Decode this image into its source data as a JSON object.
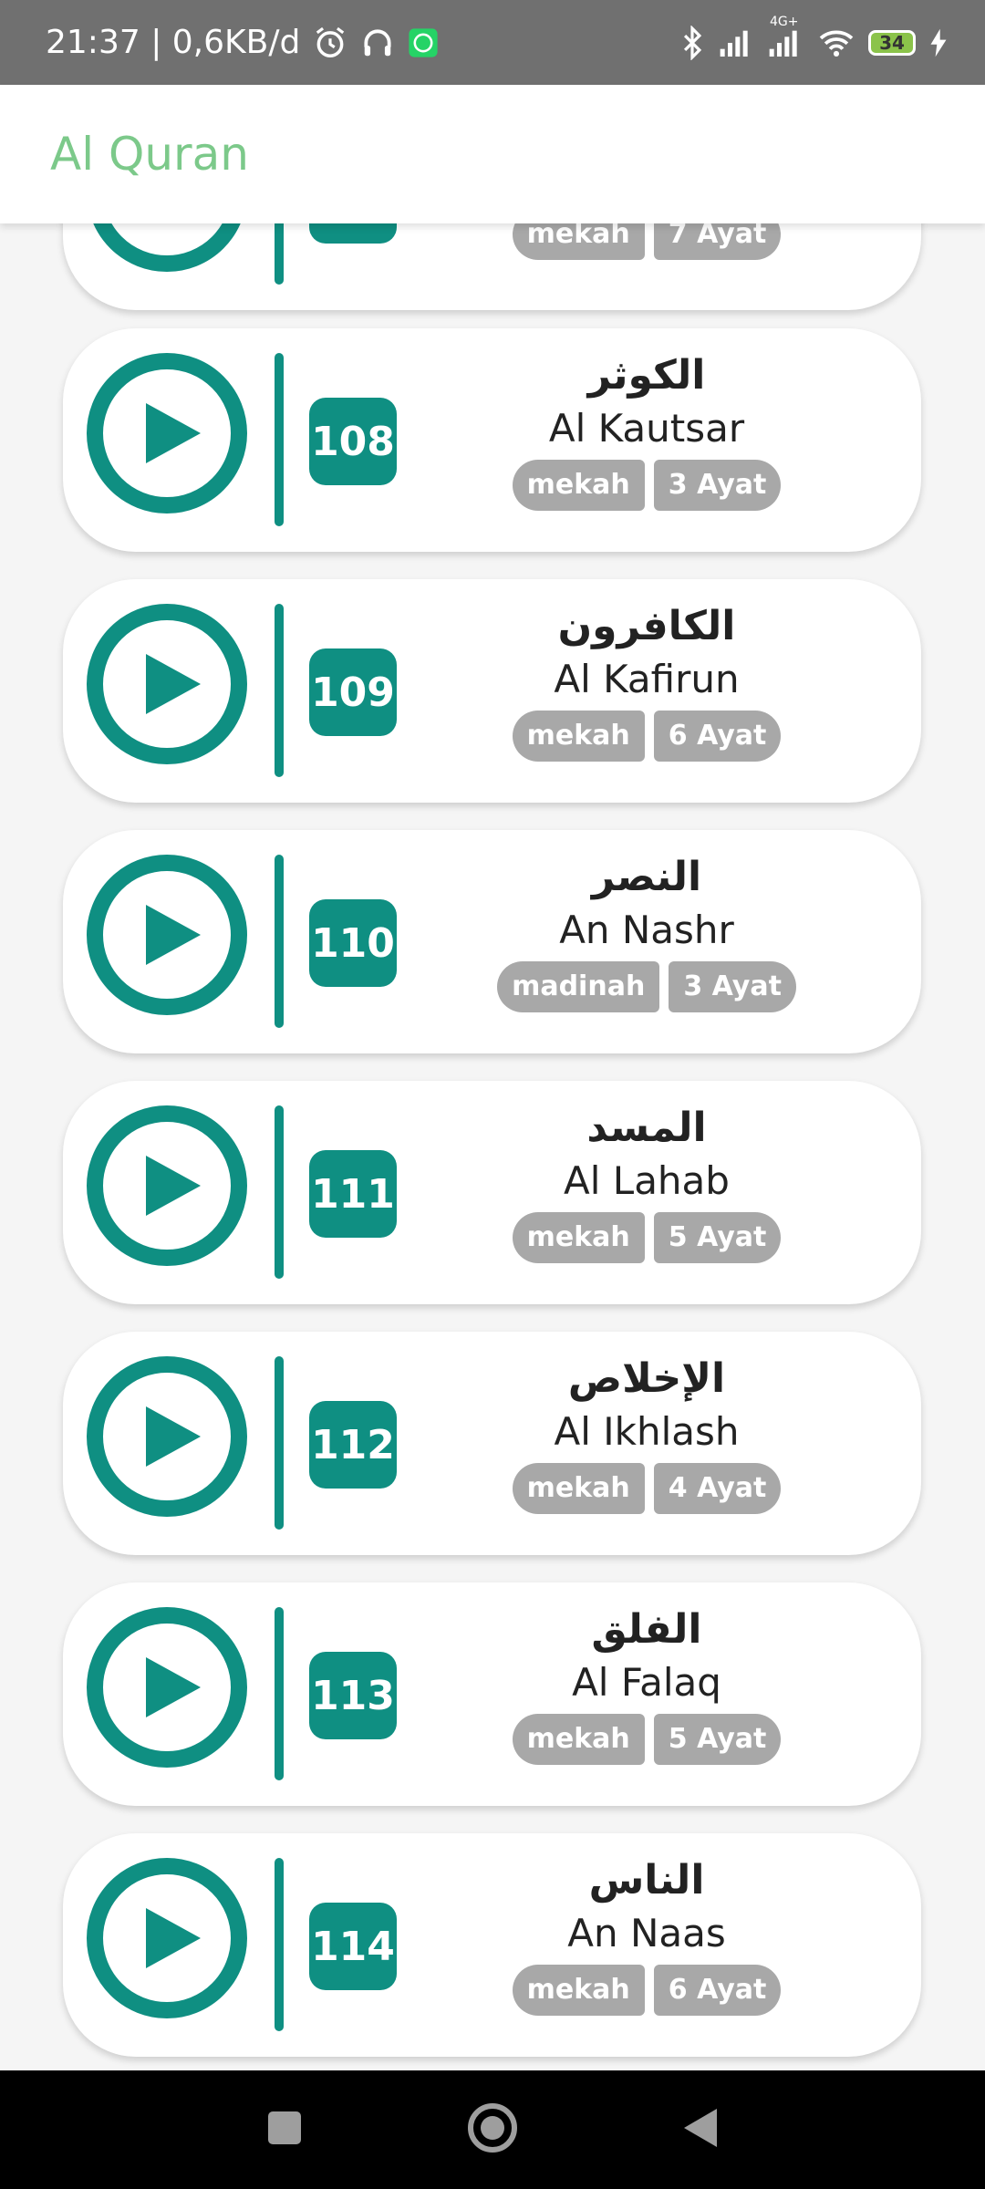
{
  "status_bar": {
    "time_network": "21:37 | 0,6KB/d",
    "network_type": "4G+",
    "battery": "34",
    "icons": [
      "alarm-icon",
      "headphones-icon",
      "whatsapp-icon",
      "bluetooth-icon",
      "signal-icon",
      "wifi-icon",
      "battery-icon",
      "charging-icon"
    ]
  },
  "app": {
    "title": "Al Quran"
  },
  "partial_item": {
    "place": "mekah",
    "ayat": "7 Ayat"
  },
  "surahs": [
    {
      "number": "108",
      "arabic": "الكوثر",
      "latin": "Al Kautsar",
      "place": "mekah",
      "ayat": "3 Ayat"
    },
    {
      "number": "109",
      "arabic": "الكافرون",
      "latin": "Al Kafirun",
      "place": "mekah",
      "ayat": "6 Ayat"
    },
    {
      "number": "110",
      "arabic": "النصر",
      "latin": "An Nashr",
      "place": "madinah",
      "ayat": "3 Ayat"
    },
    {
      "number": "111",
      "arabic": "المسد",
      "latin": "Al Lahab",
      "place": "mekah",
      "ayat": "5 Ayat"
    },
    {
      "number": "112",
      "arabic": "الإخلاص",
      "latin": "Al Ikhlash",
      "place": "mekah",
      "ayat": "4 Ayat"
    },
    {
      "number": "113",
      "arabic": "الفلق",
      "latin": "Al Falaq",
      "place": "mekah",
      "ayat": "5 Ayat"
    },
    {
      "number": "114",
      "arabic": "الناس",
      "latin": "An Naas",
      "place": "mekah",
      "ayat": "6 Ayat"
    }
  ],
  "colors": {
    "accent": "#0f8f82",
    "title": "#7cc98a",
    "badge": "#a8a8a8"
  },
  "nav": [
    "recent-apps-icon",
    "home-icon",
    "back-icon"
  ]
}
